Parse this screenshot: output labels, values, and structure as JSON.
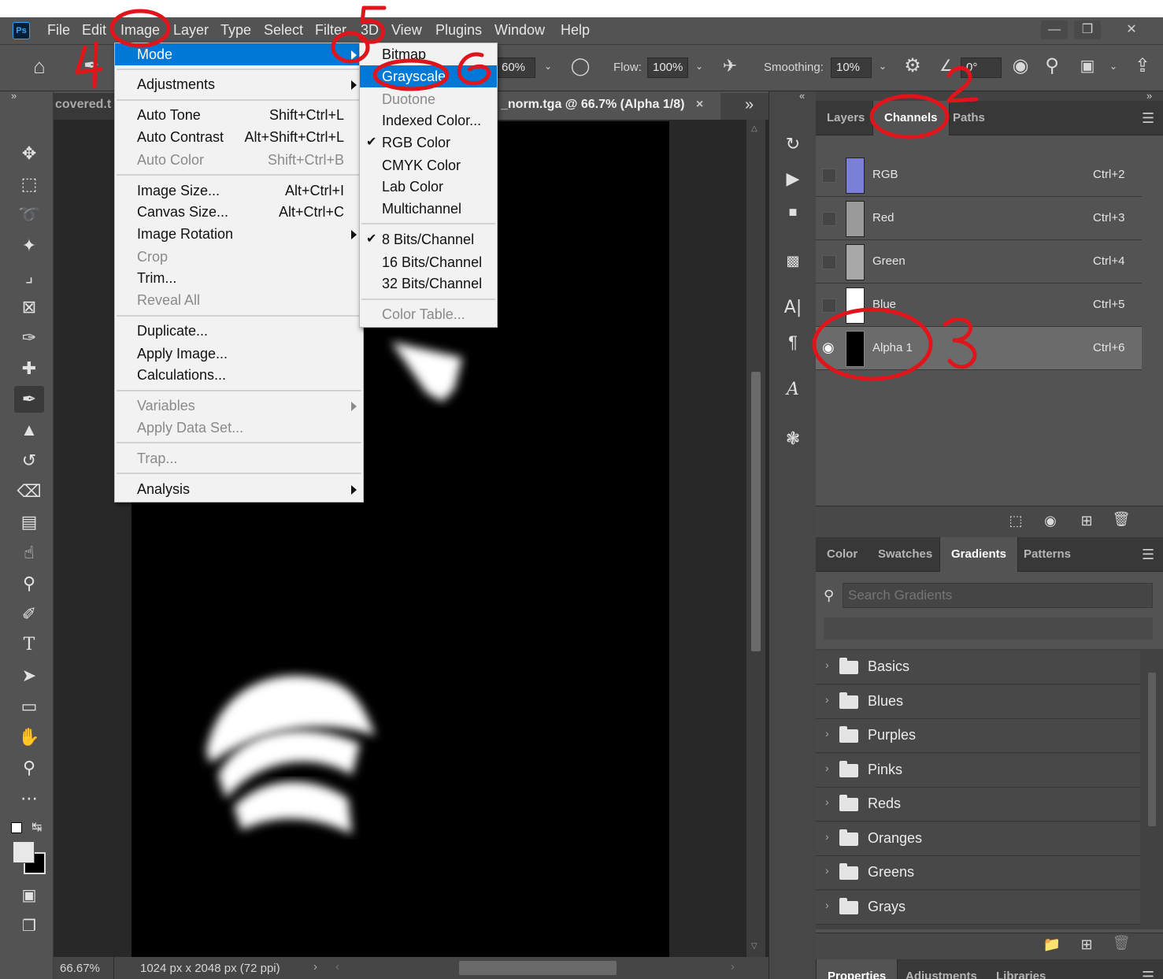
{
  "menubar": {
    "logo": "Ps",
    "items": [
      "File",
      "Edit",
      "Image",
      "Layer",
      "Type",
      "Select",
      "Filter",
      "3D",
      "View",
      "Plugins",
      "Window",
      "Help"
    ],
    "window_controls": [
      "—",
      "❒",
      "✕"
    ]
  },
  "options": {
    "opacity_value": "60%",
    "flow_label": "Flow:",
    "flow_value": "100%",
    "smoothing_label": "Smoothing:",
    "smoothing_value": "10%",
    "angle_value": "0°"
  },
  "document": {
    "tab_left_partial": "covered.t",
    "tab_title": "_norm.tga @ 66.7% (Alpha 1/8)",
    "tab_close": "×",
    "status_zoom": "66.67%",
    "status_info": "1024 px x 2048 px (72 ppi)"
  },
  "image_menu": {
    "items": [
      {
        "label": "Mode",
        "shortcut": "",
        "submenu": true,
        "disabled": false,
        "highlighted": true
      },
      {
        "label": "Adjustments",
        "shortcut": "",
        "submenu": true,
        "disabled": false
      },
      {
        "label": "Auto Tone",
        "shortcut": "Shift+Ctrl+L",
        "submenu": false,
        "disabled": false
      },
      {
        "label": "Auto Contrast",
        "shortcut": "Alt+Shift+Ctrl+L",
        "submenu": false,
        "disabled": false
      },
      {
        "label": "Auto Color",
        "shortcut": "Shift+Ctrl+B",
        "submenu": false,
        "disabled": true
      },
      {
        "label": "Image Size...",
        "shortcut": "Alt+Ctrl+I",
        "submenu": false,
        "disabled": false
      },
      {
        "label": "Canvas Size...",
        "shortcut": "Alt+Ctrl+C",
        "submenu": false,
        "disabled": false
      },
      {
        "label": "Image Rotation",
        "shortcut": "",
        "submenu": true,
        "disabled": false
      },
      {
        "label": "Crop",
        "shortcut": "",
        "submenu": false,
        "disabled": true
      },
      {
        "label": "Trim...",
        "shortcut": "",
        "submenu": false,
        "disabled": false
      },
      {
        "label": "Reveal All",
        "shortcut": "",
        "submenu": false,
        "disabled": true
      },
      {
        "label": "Duplicate...",
        "shortcut": "",
        "submenu": false,
        "disabled": false
      },
      {
        "label": "Apply Image...",
        "shortcut": "",
        "submenu": false,
        "disabled": false
      },
      {
        "label": "Calculations...",
        "shortcut": "",
        "submenu": false,
        "disabled": false
      },
      {
        "label": "Variables",
        "shortcut": "",
        "submenu": true,
        "disabled": true
      },
      {
        "label": "Apply Data Set...",
        "shortcut": "",
        "submenu": false,
        "disabled": true
      },
      {
        "label": "Trap...",
        "shortcut": "",
        "submenu": false,
        "disabled": true
      },
      {
        "label": "Analysis",
        "shortcut": "",
        "submenu": true,
        "disabled": false
      }
    ]
  },
  "mode_menu": {
    "items": [
      {
        "label": "Bitmap",
        "checked": false,
        "disabled": false
      },
      {
        "label": "Grayscale",
        "checked": false,
        "disabled": false,
        "highlighted": true
      },
      {
        "label": "Duotone",
        "checked": false,
        "disabled": true
      },
      {
        "label": "Indexed Color...",
        "checked": false,
        "disabled": false
      },
      {
        "label": "RGB Color",
        "checked": true,
        "disabled": false
      },
      {
        "label": "CMYK Color",
        "checked": false,
        "disabled": false
      },
      {
        "label": "Lab Color",
        "checked": false,
        "disabled": false
      },
      {
        "label": "Multichannel",
        "checked": false,
        "disabled": false
      },
      {
        "label": "8 Bits/Channel",
        "checked": true,
        "disabled": false
      },
      {
        "label": "16 Bits/Channel",
        "checked": false,
        "disabled": false
      },
      {
        "label": "32 Bits/Channel",
        "checked": false,
        "disabled": false
      },
      {
        "label": "Color Table...",
        "checked": false,
        "disabled": true
      }
    ]
  },
  "channels_panel": {
    "tabs": [
      "Layers",
      "Channels",
      "Paths"
    ],
    "active_tab": "Channels",
    "channels": [
      {
        "name": "RGB",
        "shortcut": "Ctrl+2",
        "thumb_color": "#7b7fd9"
      },
      {
        "name": "Red",
        "shortcut": "Ctrl+3",
        "thumb_color": "#9a9a9a"
      },
      {
        "name": "Green",
        "shortcut": "Ctrl+4",
        "thumb_color": "#a8a8a8"
      },
      {
        "name": "Blue",
        "shortcut": "Ctrl+5",
        "thumb_color": "#ffffff"
      },
      {
        "name": "Alpha 1",
        "shortcut": "Ctrl+6",
        "thumb_color": "#000000",
        "visible": true,
        "selected": true
      }
    ]
  },
  "gradients_panel": {
    "tabs": [
      "Color",
      "Swatches",
      "Gradients",
      "Patterns"
    ],
    "active_tab": "Gradients",
    "search_placeholder": "Search Gradients",
    "folders": [
      "Basics",
      "Blues",
      "Purples",
      "Pinks",
      "Reds",
      "Oranges",
      "Greens",
      "Grays"
    ]
  },
  "properties_panel": {
    "tabs": [
      "Properties",
      "Adjustments",
      "Libraries"
    ],
    "active_tab": "Properties"
  },
  "annotations": {
    "color": "#e0141b",
    "numbers": [
      "2",
      "3",
      "4",
      "5",
      "6"
    ]
  }
}
